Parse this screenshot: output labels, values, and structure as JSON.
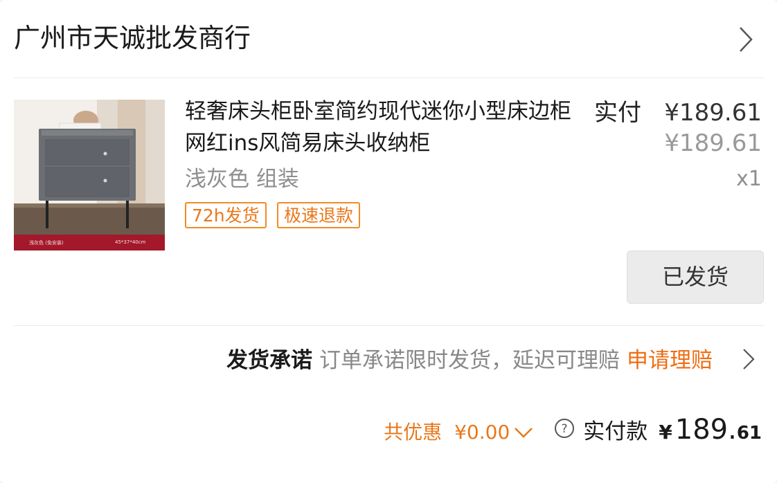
{
  "shop": {
    "name": "广州市天诚批发商行",
    "arrow_icon": "chevron-right-icon"
  },
  "product": {
    "title": "轻奢床头柜卧室简约现代迷你小型床边柜网红ins风简易床头收纳柜",
    "spec": "浅灰色 组装",
    "quantity": "x1",
    "image_caption_left": "浅灰色 (免安装)",
    "image_caption_right": "45*37*40cm",
    "tags": [
      "72h发货",
      "极速退款"
    ]
  },
  "price": {
    "paid_label": "实付",
    "paid_amount": "¥189.61",
    "original_amount": "¥189.61"
  },
  "status_button": {
    "label": "已发货"
  },
  "promise": {
    "label": "发货承诺",
    "description": "订单承诺限时发货，延迟可理赔",
    "claim_link": "申请理赔"
  },
  "footer": {
    "discount_label": "共优惠",
    "discount_amount": "¥0.00",
    "total_label": "实付款",
    "total_currency": "¥",
    "total_integer": "189.",
    "total_decimal": "61"
  },
  "colors": {
    "accent": "#ee6d13",
    "tag_border": "#f08a24",
    "muted": "#8e8e8e",
    "button_bg": "#ebebeb"
  }
}
